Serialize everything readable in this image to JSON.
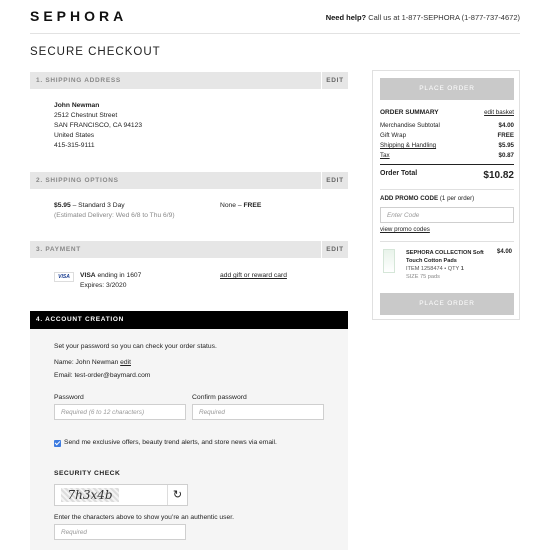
{
  "header": {
    "logo": "SEPHORA",
    "help_label": "Need help?",
    "help_text": "Call us at 1-877-SEPHORA (1-877-737-4672)"
  },
  "page_title": "SECURE CHECKOUT",
  "shipping_address": {
    "title": "1. SHIPPING ADDRESS",
    "edit": "EDIT",
    "name": "John Newman",
    "street": "2512 Chestnut Street",
    "city": "SAN FRANCISCO, CA 94123",
    "country": "United States",
    "phone": "415-315-9111"
  },
  "shipping_options": {
    "title": "2. SHIPPING OPTIONS",
    "edit": "EDIT",
    "price": "$5.95",
    "method": " – Standard 3 Day",
    "estimate": "(Estimated Delivery: Wed 6/8 to Thu 6/9)",
    "gift_none": "None – ",
    "gift_free": "FREE"
  },
  "payment": {
    "title": "3. PAYMENT",
    "edit": "EDIT",
    "card_brand": "VISA",
    "card_text": "VISA",
    "card_ending": " ending in 1607",
    "expires": "Expires: 3/2020",
    "gift_link": "add gift or reward card"
  },
  "account": {
    "title": "4. ACCOUNT CREATION",
    "intro": "Set your password so you can check your order status.",
    "name_line": "Name: John Newman",
    "name_edit": "edit",
    "email_line": "Email: test-order@baymard.com",
    "password_label": "Password",
    "password_placeholder": "Required (6 to 12 characters)",
    "confirm_label": "Confirm password",
    "confirm_placeholder": "Required",
    "optin_text": "Send me exclusive offers, beauty trend alerts, and store news via email.",
    "optin_checked": true,
    "security_title": "SECURITY CHECK",
    "captcha_text": "7h3x4b",
    "captcha_hint": "Enter the characters above to show you’re an authentic user.",
    "captcha_placeholder": "Required"
  },
  "summary": {
    "place_order": "PLACE ORDER",
    "title": "ORDER SUMMARY",
    "edit_basket": "edit basket",
    "lines": [
      {
        "label": "Merchandise Subtotal",
        "value": "$4.00"
      },
      {
        "label": "Gift Wrap",
        "value": "FREE"
      },
      {
        "label": "Shipping & Handling",
        "value": "$5.95"
      },
      {
        "label": "Tax",
        "value": "$0.87"
      }
    ],
    "total_label": "Order Total",
    "total_value": "$10.82",
    "promo_title": "ADD PROMO CODE",
    "promo_note": "(1 per order)",
    "promo_placeholder": "Enter Code",
    "promo_link": "view promo codes",
    "item": {
      "name": "SEPHORA COLLECTION Soft Touch Cotton Pads",
      "price": "$4.00",
      "item_no": "ITEM 1258474 • QTY",
      "qty": "1",
      "size": "SIZE 75 pads"
    }
  }
}
